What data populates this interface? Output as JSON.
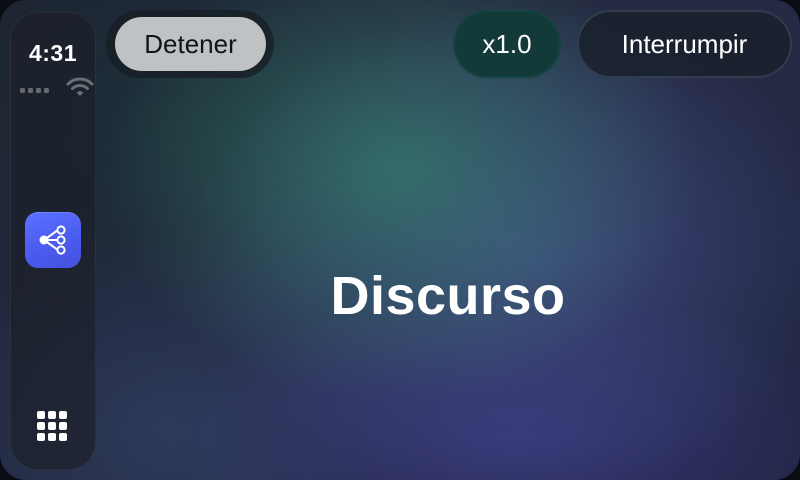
{
  "status_bar": {
    "time": "4:31",
    "wifi_icon": "wifi-icon",
    "signal_icon": "cellular-signal-icon"
  },
  "dock": {
    "app_icon": "share-nodes-icon",
    "app_icon_color": "#4f62f5",
    "home_icon": "app-grid-icon"
  },
  "toolbar": {
    "stop_label": "Detener",
    "speed_label": "x1.0",
    "interrupt_label": "Interrumpir"
  },
  "main": {
    "title": "Discurso"
  },
  "colors": {
    "stop_button_bg": "#bfc2c4",
    "speed_button_bg": "#123a38",
    "interrupt_button_bg": "#1a222e"
  }
}
